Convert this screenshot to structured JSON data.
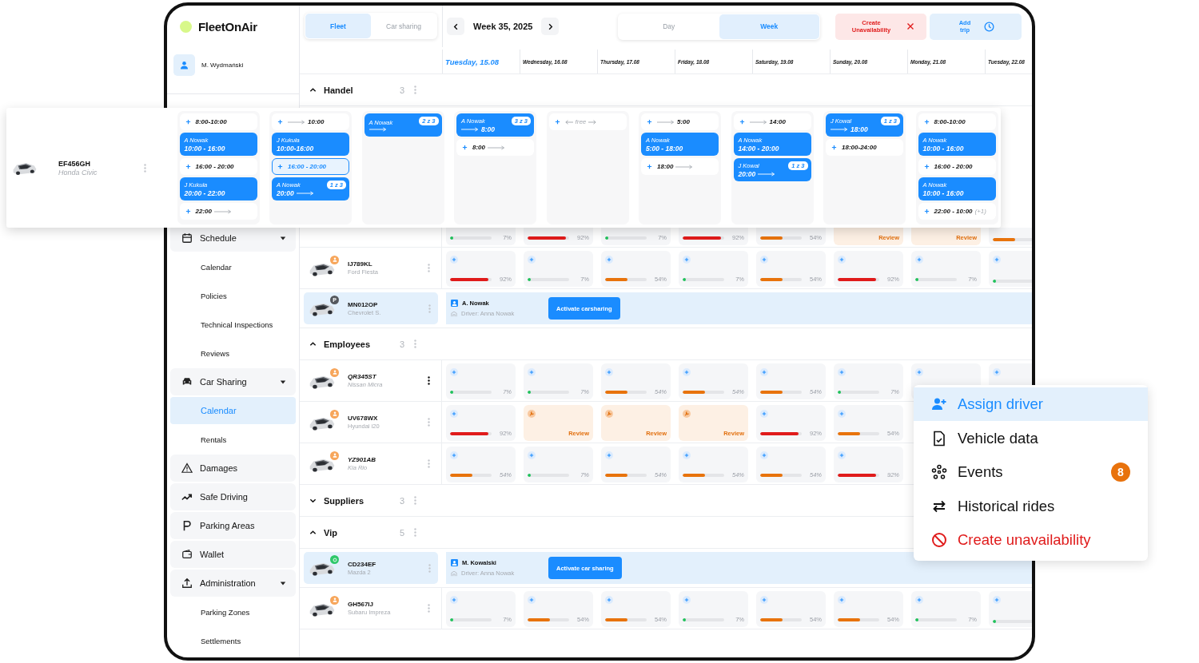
{
  "brand": {
    "name": "FleetOnAir"
  },
  "user": {
    "name": "M. Wydmański"
  },
  "sidebar": {
    "items": [
      {
        "label": "Schedule",
        "expanded": true,
        "children": [
          {
            "label": "Calendar",
            "selected": false
          },
          {
            "label": "Policies",
            "selected": false
          },
          {
            "label": "Technical Inspections",
            "selected": false
          },
          {
            "label": "Reviews",
            "selected": false
          }
        ]
      },
      {
        "label": "Car Sharing",
        "expanded": true,
        "children": [
          {
            "label": "Calendar",
            "selected": true
          },
          {
            "label": "Rentals",
            "selected": false
          }
        ]
      },
      {
        "label": "Damages"
      },
      {
        "label": "Safe Driving"
      },
      {
        "label": "Parking Areas"
      },
      {
        "label": "Wallet"
      },
      {
        "label": "Administration",
        "expanded": true,
        "children": [
          {
            "label": "Parking Zones",
            "selected": false
          },
          {
            "label": "Settlements",
            "selected": false
          }
        ]
      }
    ]
  },
  "view_tabs": [
    {
      "label": "Fleet",
      "selected": true
    },
    {
      "label": "Car sharing",
      "selected": false
    }
  ],
  "week": {
    "label": "Week 35, 2025"
  },
  "range_tabs": [
    {
      "label": "Day",
      "selected": false
    },
    {
      "label": "Week",
      "selected": true
    }
  ],
  "actions": [
    {
      "label": "Create Unavailability",
      "kind": "danger"
    },
    {
      "label": "Add trip",
      "kind": "primary"
    }
  ],
  "days": [
    {
      "label": "Tuesday, 15.08",
      "today": true
    },
    {
      "label": "Wednesday, 16.08",
      "today": false
    },
    {
      "label": "Thursday, 17.08",
      "today": false
    },
    {
      "label": "Friday, 18.08",
      "today": false
    },
    {
      "label": "Saturday, 19.08",
      "today": false
    },
    {
      "label": "Sunday, 20.08",
      "today": false
    },
    {
      "label": "Monday, 21.08",
      "today": false
    },
    {
      "label": "Tuesday, 22.08",
      "today": false
    }
  ],
  "groups": [
    {
      "name": "Handel",
      "count": "3",
      "expanded": true,
      "rows": [
        {
          "kind": "partial",
          "cells": [
            {
              "kind": "bar",
              "level": 0.07,
              "pct": "7%"
            },
            {
              "kind": "bar",
              "level": 0.92,
              "pct": "92%"
            },
            {
              "kind": "bar",
              "level": 0.07,
              "pct": "7%"
            },
            {
              "kind": "bar",
              "level": 0.92,
              "pct": "92%"
            },
            {
              "kind": "bar",
              "level": 0.54,
              "pct": "54%"
            },
            {
              "kind": "review",
              "label": "Review"
            },
            {
              "kind": "review",
              "label": "Review"
            },
            {
              "kind": "bar",
              "level": 0.54
            }
          ]
        },
        {
          "kind": "cells",
          "plate": "IJ789KL",
          "model": "Ford Fiesta",
          "badge": {
            "kind": "driver"
          },
          "italic": false,
          "menu_open": false,
          "cells": [
            {
              "kind": "bar",
              "level": 0.92,
              "pct": "92%"
            },
            {
              "kind": "bar",
              "level": 0.07,
              "pct": "7%"
            },
            {
              "kind": "bar",
              "level": 0.54,
              "pct": "54%"
            },
            {
              "kind": "bar",
              "level": 0.07,
              "pct": "7%"
            },
            {
              "kind": "bar",
              "level": 0.54,
              "pct": "54%"
            },
            {
              "kind": "bar",
              "level": 0.92,
              "pct": "92%"
            },
            {
              "kind": "bar",
              "level": 0.07,
              "pct": "7%"
            },
            {
              "kind": "bar",
              "level": 0.07
            }
          ]
        },
        {
          "kind": "carsharing",
          "plate": "MN012OP",
          "model": "Chevrolet S.",
          "badge": {
            "kind": "parking",
            "text": "P"
          },
          "driver": "A. Nowak",
          "note": "Driver: Anna Nowak",
          "button": "Activate carsharing"
        }
      ]
    },
    {
      "name": "Employees",
      "count": "3",
      "expanded": true,
      "rows": [
        {
          "kind": "cells",
          "plate": "QR345ST",
          "model": "Nissan Micra",
          "badge": {
            "kind": "driver"
          },
          "italic": true,
          "menu_open": true,
          "cells": [
            {
              "kind": "bar",
              "level": 0.07,
              "pct": "7%"
            },
            {
              "kind": "bar",
              "level": 0.07,
              "pct": "7%"
            },
            {
              "kind": "bar",
              "level": 0.54,
              "pct": "54%"
            },
            {
              "kind": "bar",
              "level": 0.54,
              "pct": "54%"
            },
            {
              "kind": "bar",
              "level": 0.54,
              "pct": "54%"
            },
            {
              "kind": "bar",
              "level": 0.07,
              "pct": "7%"
            },
            {
              "kind": "blank"
            },
            {
              "kind": "blank"
            }
          ]
        },
        {
          "kind": "cells",
          "plate": "UV678WX",
          "model": "Hyundai i20",
          "badge": {
            "kind": "driver"
          },
          "italic": false,
          "menu_open": false,
          "cells": [
            {
              "kind": "bar",
              "level": 0.92,
              "pct": "92%"
            },
            {
              "kind": "review",
              "label": "Review"
            },
            {
              "kind": "review",
              "label": "Review"
            },
            {
              "kind": "review",
              "label": "Review"
            },
            {
              "kind": "bar",
              "level": 0.92,
              "pct": "92%"
            },
            {
              "kind": "bar",
              "level": 0.54,
              "pct": "54%"
            }
          ]
        },
        {
          "kind": "cells",
          "plate": "YZ901AB",
          "model": "Kia Rio",
          "badge": {
            "kind": "driver"
          },
          "italic": true,
          "menu_open": false,
          "cells": [
            {
              "kind": "bar",
              "level": 0.54,
              "pct": "54%"
            },
            {
              "kind": "bar",
              "level": 0.07,
              "pct": "7%"
            },
            {
              "kind": "bar",
              "level": 0.54,
              "pct": "54%"
            },
            {
              "kind": "bar",
              "level": 0.54,
              "pct": "54%"
            },
            {
              "kind": "bar",
              "level": 0.54,
              "pct": "54%"
            },
            {
              "kind": "bar",
              "level": 0.92,
              "pct": "92%"
            }
          ]
        }
      ]
    },
    {
      "name": "Suppliers",
      "count": "3",
      "expanded": false
    },
    {
      "name": "Vip",
      "count": "5",
      "expanded": true,
      "rows": [
        {
          "kind": "carsharing",
          "plate": "CD234EF",
          "model": "Mazda 2",
          "badge": {
            "kind": "carsharing"
          },
          "driver": "M. Kowalski",
          "note": "Driver: Anna Nowak",
          "button": "Activate car sharing"
        },
        {
          "kind": "cells",
          "plate": "GH567IJ",
          "model": "Subaru Impreza",
          "badge": {
            "kind": "driver"
          },
          "italic": false,
          "menu_open": false,
          "cells": [
            {
              "kind": "bar",
              "level": 0.07,
              "pct": "7%"
            },
            {
              "kind": "bar",
              "level": 0.54,
              "pct": "54%"
            },
            {
              "kind": "bar",
              "level": 0.54,
              "pct": "54%"
            },
            {
              "kind": "bar",
              "level": 0.07,
              "pct": "7%"
            },
            {
              "kind": "bar",
              "level": 0.54,
              "pct": "54%"
            },
            {
              "kind": "bar",
              "level": 0.54,
              "pct": "54%"
            },
            {
              "kind": "bar",
              "level": 0.07,
              "pct": "7%"
            },
            {
              "kind": "bar",
              "level": 0.07
            }
          ]
        }
      ]
    }
  ],
  "expanded_vehicle": {
    "plate": "EF456GH",
    "model": "Honda Civic",
    "days": [
      {
        "slots": [
          {
            "kind": "free",
            "time": "8:00-10:00",
            "selected": false,
            "arrow_before": false,
            "arrow_after": false
          },
          {
            "kind": "booking",
            "name": "A Nowak",
            "time": "10:00 - 16:00",
            "arrow_before": false,
            "arrow_after": false
          },
          {
            "kind": "free",
            "time": "16:00 - 20:00",
            "selected": false,
            "arrow_before": false,
            "arrow_after": false
          },
          {
            "kind": "booking",
            "name": "J Kukuła",
            "time": "20:00 - 22:00",
            "arrow_before": false,
            "arrow_after": false
          },
          {
            "kind": "free",
            "time": "22:00",
            "selected": false,
            "arrow_before": false,
            "arrow_after": true
          }
        ]
      },
      {
        "slots": [
          {
            "kind": "free",
            "time": "10:00",
            "selected": false,
            "arrow_before": true,
            "arrow_after": false
          },
          {
            "kind": "booking",
            "name": "J Kukuła",
            "time": "10:00-16:00",
            "arrow_before": false,
            "arrow_after": false
          },
          {
            "kind": "free",
            "time": "16:00 - 20:00",
            "selected": true,
            "arrow_before": false,
            "arrow_after": false
          },
          {
            "kind": "booking",
            "name": "A Nowak",
            "time": "20:00",
            "arrow_before": false,
            "arrow_after": true,
            "badge": "1 z 3"
          }
        ]
      },
      {
        "slots": [
          {
            "kind": "booking",
            "name": "A Nowak",
            "arrow_before": false,
            "arrow_after": true,
            "badge": "2 z 3"
          }
        ]
      },
      {
        "slots": [
          {
            "kind": "booking",
            "name": "A Nowak",
            "time": "8:00",
            "arrow_before": true,
            "arrow_after": false,
            "badge": "3 z 3"
          },
          {
            "kind": "free",
            "time": "8:00",
            "selected": false,
            "arrow_before": false,
            "arrow_after": true
          }
        ]
      },
      {
        "slots": [
          {
            "kind": "open",
            "text": "free"
          }
        ]
      },
      {
        "slots": [
          {
            "kind": "free",
            "time": "5:00",
            "selected": false,
            "arrow_before": true,
            "arrow_after": false
          },
          {
            "kind": "booking",
            "name": "A Nowak",
            "time": "5:00 - 18:00",
            "arrow_before": false,
            "arrow_after": false
          },
          {
            "kind": "free",
            "time": "18:00",
            "selected": false,
            "arrow_before": false,
            "arrow_after": true
          }
        ]
      },
      {
        "slots": [
          {
            "kind": "free",
            "time": "14:00",
            "selected": false,
            "arrow_before": true,
            "arrow_after": false
          },
          {
            "kind": "booking",
            "name": "A Nowak",
            "time": "14:00 - 20:00",
            "arrow_before": false,
            "arrow_after": false
          },
          {
            "kind": "booking",
            "name": "J Kowal",
            "time": "20:00",
            "arrow_before": false,
            "arrow_after": true,
            "badge": "1 z 3"
          }
        ]
      },
      {
        "slots": [
          {
            "kind": "booking",
            "name": "J Kowal",
            "time": "18:00",
            "arrow_before": true,
            "arrow_after": false,
            "badge": "1 z 3"
          },
          {
            "kind": "free",
            "time": "18:00-24:00",
            "selected": false,
            "arrow_before": false,
            "arrow_after": false
          }
        ]
      },
      {
        "slots": [
          {
            "kind": "free",
            "time": "8:00-10:00",
            "selected": false,
            "arrow_before": false,
            "arrow_after": false
          },
          {
            "kind": "booking",
            "name": "A Nowak",
            "time": "10:00 - 16:00",
            "arrow_before": false,
            "arrow_after": false
          },
          {
            "kind": "free",
            "time": "16:00 - 20:00",
            "selected": false,
            "arrow_before": false,
            "arrow_after": false
          },
          {
            "kind": "booking",
            "name": "A Nowak",
            "time": "10:00 - 16:00",
            "arrow_before": false,
            "arrow_after": false
          },
          {
            "kind": "free",
            "time": "22:00 - 10:00",
            "note": "(+1)",
            "selected": false,
            "arrow_before": false,
            "arrow_after": false
          }
        ]
      }
    ]
  },
  "menu": {
    "items": [
      {
        "label": "Assign driver",
        "selected": true,
        "danger": false
      },
      {
        "label": "Vehicle data",
        "selected": false,
        "danger": false
      },
      {
        "label": "Events",
        "selected": false,
        "danger": false,
        "badge": "8"
      },
      {
        "label": "Historical rides",
        "selected": false,
        "danger": false
      },
      {
        "label": "Create unavailability",
        "selected": false,
        "danger": true
      }
    ]
  }
}
